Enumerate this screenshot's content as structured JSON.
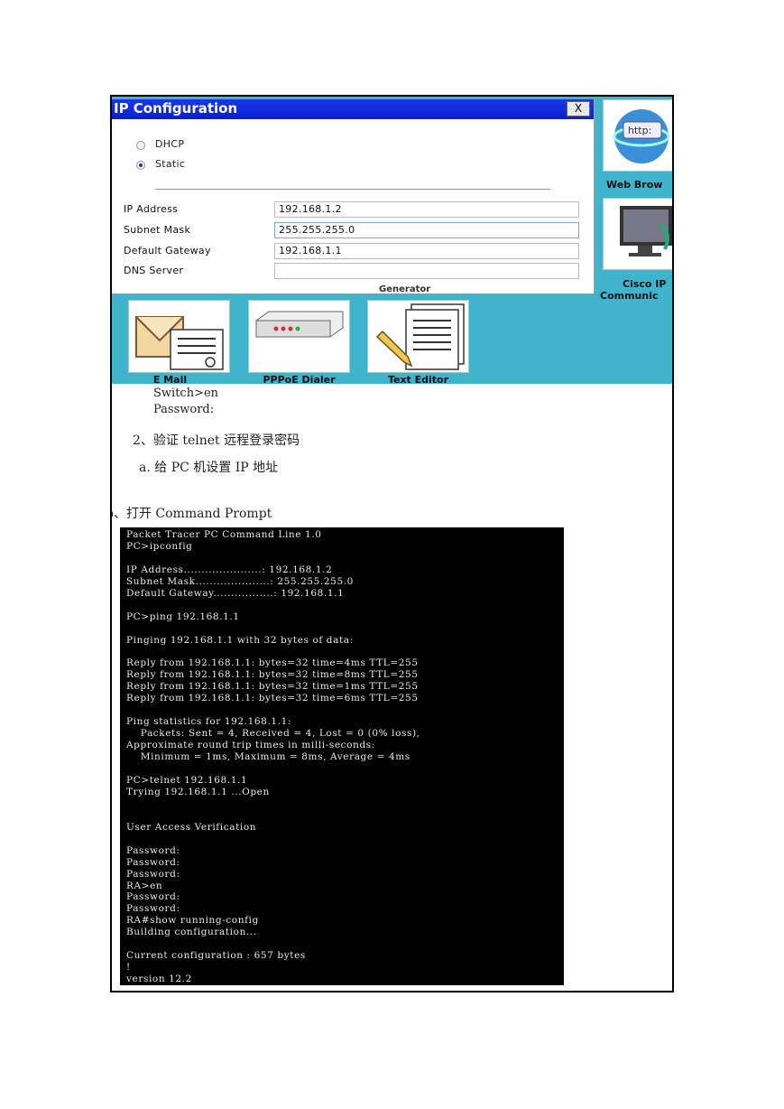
{
  "ip_window": {
    "title": "IP Configuration",
    "close_label": "X",
    "mode_options": [
      "DHCP",
      "Static"
    ],
    "selected_mode": "Static",
    "fields": [
      {
        "label": "IP Address",
        "value": "192.168.1.2"
      },
      {
        "label": "Subnet Mask",
        "value": "255.255.255.0"
      },
      {
        "label": "Default Gateway",
        "value": "192.168.1.1"
      },
      {
        "label": "DNS Server",
        "value": ""
      }
    ]
  },
  "desktop_icons": {
    "web_browser_label": "Web Brow",
    "web_browser_badge": "http:",
    "cisco_label_1": "Cisco IP",
    "cisco_label_2": "Communic",
    "email_label": "E Mail",
    "pppoe_label": "PPPoE Dialer",
    "text_editor_label": "Text Editor",
    "partial_label": "Generator"
  },
  "doc": {
    "line1": "Switch>en",
    "line2": "Password:",
    "step2": "2、验证 telnet 远程登录密码",
    "step_a": "a. 给 PC 机设置 IP 地址",
    "step_b": "b、打开 Command Prompt"
  },
  "terminal": {
    "lines": [
      "Packet Tracer PC Command Line 1.0",
      "PC>ipconfig",
      "",
      "IP Address......................: 192.168.1.2",
      "Subnet Mask.....................: 255.255.255.0",
      "Default Gateway.................: 192.168.1.1",
      "",
      "PC>ping 192.168.1.1",
      "",
      "Pinging 192.168.1.1 with 32 bytes of data:",
      "",
      "Reply from 192.168.1.1: bytes=32 time=4ms TTL=255",
      "Reply from 192.168.1.1: bytes=32 time=8ms TTL=255",
      "Reply from 192.168.1.1: bytes=32 time=1ms TTL=255",
      "Reply from 192.168.1.1: bytes=32 time=6ms TTL=255",
      "",
      "Ping statistics for 192.168.1.1:",
      "    Packets: Sent = 4, Received = 4, Lost = 0 (0% loss),",
      "Approximate round trip times in milli-seconds:",
      "    Minimum = 1ms, Maximum = 8ms, Average = 4ms",
      "",
      "PC>telnet 192.168.1.1",
      "Trying 192.168.1.1 ...Open",
      "",
      "",
      "User Access Verification",
      "",
      "Password:",
      "Password:",
      "Password:",
      "RA>en",
      "Password:",
      "Password:",
      "RA#show running-config",
      "Building configuration...",
      "",
      "Current configuration : 657 bytes",
      "!",
      "version 12.2"
    ]
  }
}
